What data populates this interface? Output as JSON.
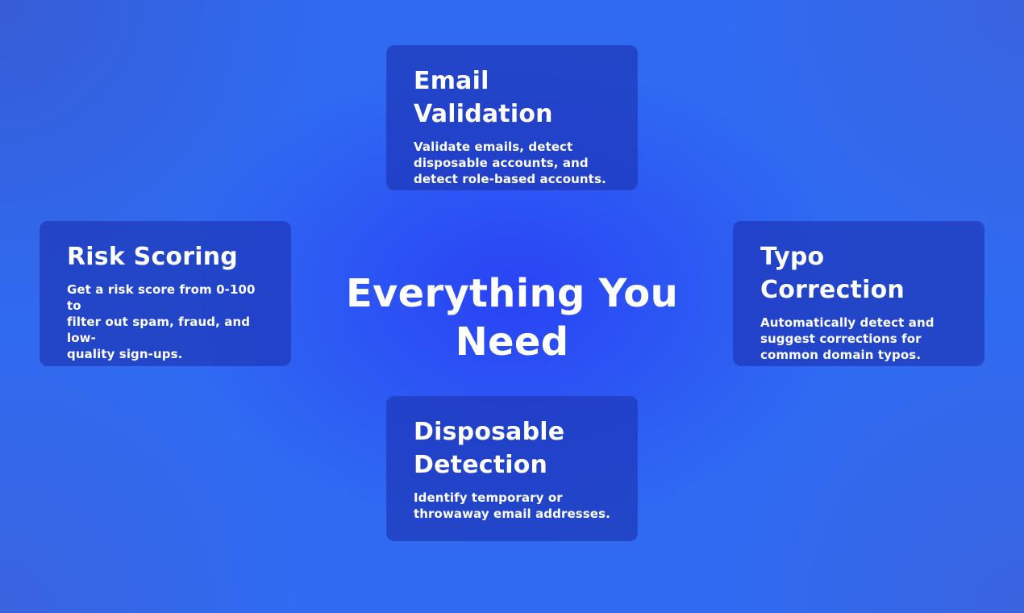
{
  "heading": "Everything You Need",
  "cards": {
    "top": {
      "title": "Email Validation",
      "description": "Validate emails, detect\ndisposable accounts, and\ndetect role-based accounts."
    },
    "left": {
      "title": "Risk Scoring",
      "description": "Get a risk score from 0-100 to\nfilter out spam, fraud, and low-\nquality sign-ups."
    },
    "right": {
      "title": "Typo Correction",
      "description": "Automatically detect and\nsuggest corrections for\ncommon domain typos."
    },
    "bottom": {
      "title": "Disposable\nDetection",
      "description": "Identify temporary or\nthrowaway email addresses."
    }
  },
  "colors": {
    "background": "#2f6bf2",
    "center_glow": "#283cf5",
    "card_fill": "#1e37b9",
    "text": "#ffffff"
  }
}
